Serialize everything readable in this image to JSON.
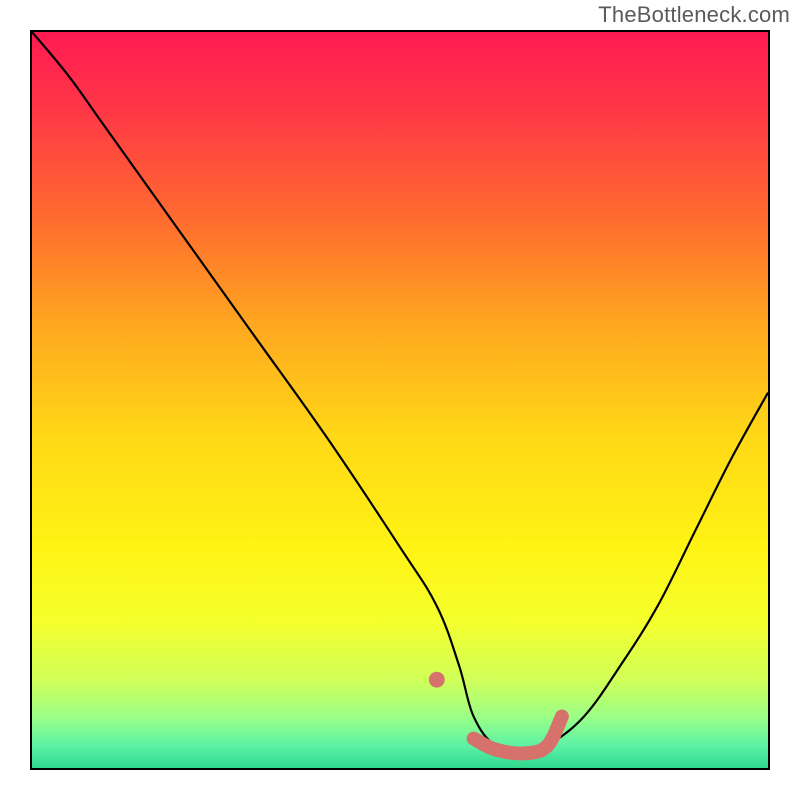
{
  "attribution": "TheBottleneck.com",
  "chart_data": {
    "type": "line",
    "title": "",
    "xlabel": "",
    "ylabel": "",
    "xlim": [
      0,
      100
    ],
    "ylim": [
      0,
      100
    ],
    "series": [
      {
        "name": "curve",
        "color": "#000000",
        "x": [
          0,
          5,
          10,
          20,
          30,
          40,
          50,
          55,
          58,
          60,
          63,
          67,
          70,
          75,
          80,
          85,
          90,
          95,
          100
        ],
        "y": [
          100,
          94,
          87,
          73,
          59,
          45,
          30,
          22,
          14,
          7,
          3,
          2,
          3,
          7,
          14,
          22,
          32,
          42,
          51
        ]
      },
      {
        "name": "highlight",
        "color": "#d6726b",
        "x": [
          55,
          58,
          60,
          63,
          67,
          70,
          72
        ],
        "y": [
          12,
          9,
          4,
          2.5,
          2,
          3,
          7
        ]
      }
    ],
    "gradient_stops": [
      {
        "offset": 0.0,
        "color": "#ff1a52"
      },
      {
        "offset": 0.1,
        "color": "#ff3547"
      },
      {
        "offset": 0.25,
        "color": "#ff6a2f"
      },
      {
        "offset": 0.4,
        "color": "#ffa81f"
      },
      {
        "offset": 0.55,
        "color": "#ffd816"
      },
      {
        "offset": 0.7,
        "color": "#fff314"
      },
      {
        "offset": 0.8,
        "color": "#f5ff2c"
      },
      {
        "offset": 0.88,
        "color": "#d0ff58"
      },
      {
        "offset": 0.93,
        "color": "#9cff86"
      },
      {
        "offset": 0.97,
        "color": "#5cf2a6"
      },
      {
        "offset": 1.0,
        "color": "#2fd88f"
      }
    ]
  }
}
